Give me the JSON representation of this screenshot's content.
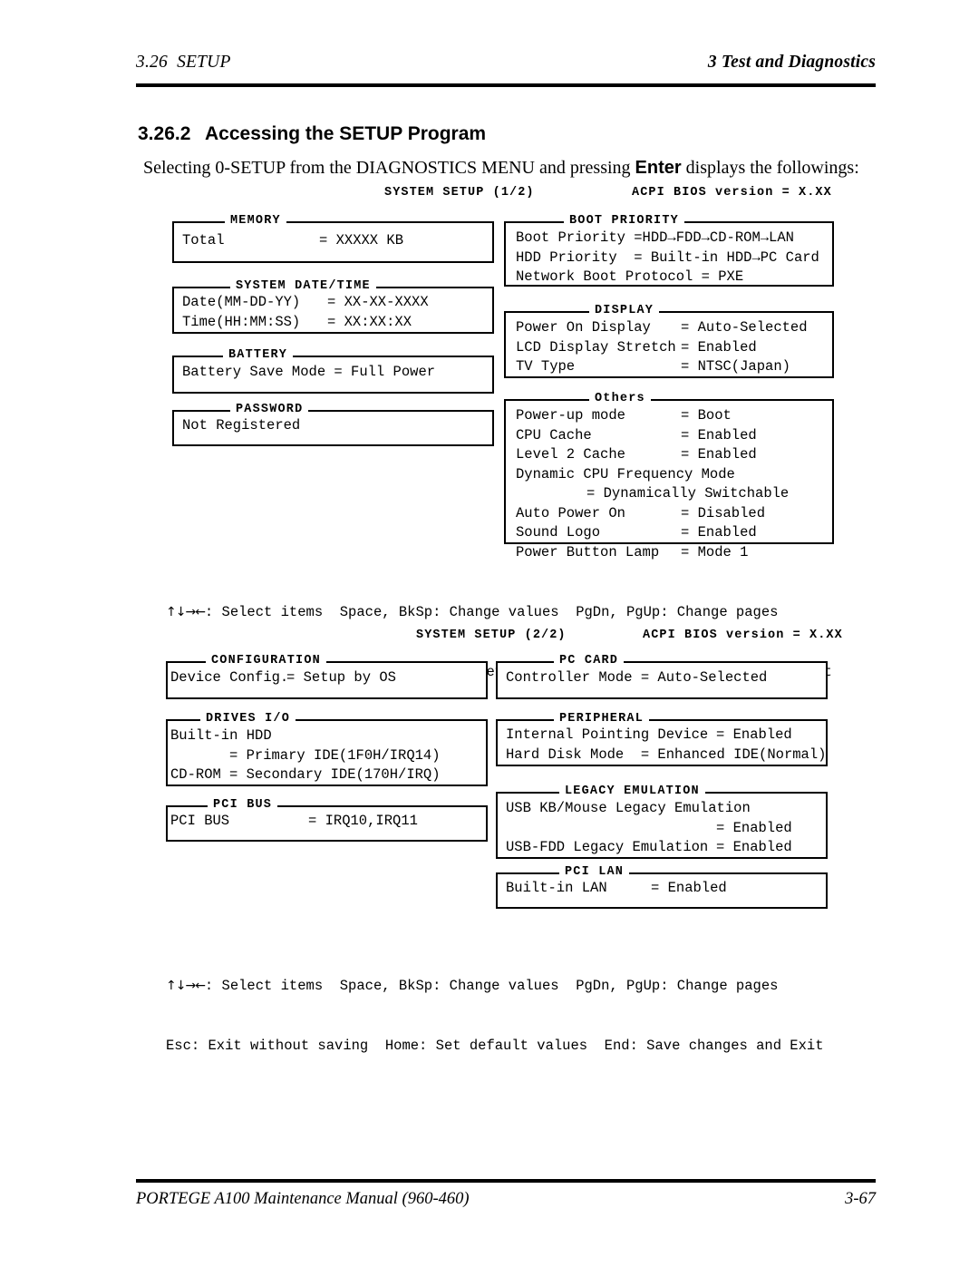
{
  "header": {
    "left": "3.26  SETUP",
    "right": "3 Test and Diagnostics"
  },
  "section": {
    "number": "3.26.2",
    "title": "Accessing the SETUP Program",
    "intro_a": "Selecting 0-SETUP from the DIAGNOSTICS MENU and pressing ",
    "intro_key": "Enter",
    "intro_b": " displays the followings:"
  },
  "screen1": {
    "title_left": "SYSTEM SETUP (1/2)",
    "title_right": "ACPI BIOS version = X.XX",
    "panels": [
      {
        "name": "memory",
        "title": "MEMORY",
        "rows": [
          {
            "k": "Total",
            "v": "= XXXXX KB"
          }
        ]
      },
      {
        "name": "system-date-time",
        "title": "SYSTEM DATE/TIME",
        "rows": [
          {
            "k": "Date(MM-DD-YY)",
            "v": "= XX-XX-XXXX"
          },
          {
            "k": "Time(HH:MM:SS)",
            "v": "= XX:XX:XX"
          }
        ]
      },
      {
        "name": "battery",
        "title": "BATTERY",
        "rows": [
          {
            "k": "Battery Save Mode = Full Power",
            "v": ""
          }
        ]
      },
      {
        "name": "password",
        "title": "PASSWORD",
        "rows": [
          {
            "k": "Not Registered",
            "v": ""
          }
        ]
      },
      {
        "name": "boot-priority",
        "title": "BOOT PRIORITY",
        "rows": [
          {
            "k": "Boot Priority =HDD→FDD→CD-ROM→LAN",
            "v": ""
          },
          {
            "k": "HDD Priority  = Built-in HDD→PC Card",
            "v": ""
          },
          {
            "k": "Network Boot Protocol = PXE",
            "v": ""
          }
        ]
      },
      {
        "name": "display",
        "title": "DISPLAY",
        "rows": [
          {
            "k": "Power On Display",
            "v": "= Auto-Selected"
          },
          {
            "k": "LCD Display Stretch",
            "v": "= Enabled"
          },
          {
            "k": "TV Type",
            "v": "= NTSC(Japan)"
          }
        ]
      },
      {
        "name": "others",
        "title": "Others",
        "rows": [
          {
            "k": "Power-up mode",
            "v": "= Boot"
          },
          {
            "k": "CPU Cache",
            "v": "= Enabled"
          },
          {
            "k": "Level 2 Cache",
            "v": "= Enabled"
          },
          {
            "k": "Dynamic CPU Frequency Mode",
            "v": ""
          },
          {
            "k": "        ",
            "v": "= Dynamically Switchable"
          },
          {
            "k": "Auto Power On",
            "v": "= Disabled"
          },
          {
            "k": "Sound Logo",
            "v": "= Enabled"
          },
          {
            "k": "Power Button Lamp",
            "v": "= Mode 1"
          }
        ]
      }
    ],
    "help_line1": ": Select items  Space, BkSp: Change values  PgDn, PgUp: Change pages",
    "help_line2": "Esc: Exit without saving  Home : Set default values  End: Save changes and Exit",
    "help_arrows": "↑↓→←"
  },
  "screen2": {
    "title_left": "SYSTEM SETUP (2/2)",
    "title_right": "ACPI BIOS version = X.XX",
    "panels": [
      {
        "name": "configuration",
        "title": "CONFIGURATION",
        "rows": [
          {
            "k": "Device Config.",
            "v": "= Setup by OS"
          }
        ]
      },
      {
        "name": "drives-io",
        "title": "DRIVES I/O",
        "rows": [
          {
            "k": "Built-in HDD",
            "v": ""
          },
          {
            "k": "        ",
            "v": "= Primary IDE(1F0H/IRQ14)"
          },
          {
            "k": "CD-ROM",
            "v": "= Secondary IDE(170H/IRQ)"
          }
        ]
      },
      {
        "name": "pci-bus",
        "title": "PCI BUS",
        "rows": [
          {
            "k": "PCI BUS",
            "v": "= IRQ10,IRQ11"
          }
        ]
      },
      {
        "name": "pc-card",
        "title": "PC CARD",
        "rows": [
          {
            "k": "Controller Mode = Auto-Selected",
            "v": ""
          }
        ]
      },
      {
        "name": "peripheral",
        "title": "PERIPHERAL",
        "rows": [
          {
            "k": "Internal Pointing Device",
            "v": "= Enabled"
          },
          {
            "k": "Hard Disk Mode  = Enhanced IDE(Normal)",
            "v": ""
          }
        ]
      },
      {
        "name": "legacy-emulation",
        "title": "LEGACY EMULATION",
        "rows": [
          {
            "k": "USB KB/Mouse Legacy Emulation",
            "v": ""
          },
          {
            "k": "               ",
            "v": "= Enabled"
          },
          {
            "k": "USB-FDD Legacy Emulation",
            "v": "= Enabled"
          }
        ]
      },
      {
        "name": "pci-lan",
        "title": "PCI LAN",
        "rows": [
          {
            "k": "Built-in LAN",
            "v": "= Enabled"
          }
        ]
      }
    ],
    "help_line1": ": Select items  Space, BkSp: Change values  PgDn, PgUp: Change pages",
    "help_line2": "Esc: Exit without saving  Home: Set default values  End: Save changes and Exit",
    "help_arrows": "↑↓→←"
  },
  "footer": {
    "left": "PORTEGE A100 Maintenance Manual (960-460)",
    "right": "3-67"
  }
}
